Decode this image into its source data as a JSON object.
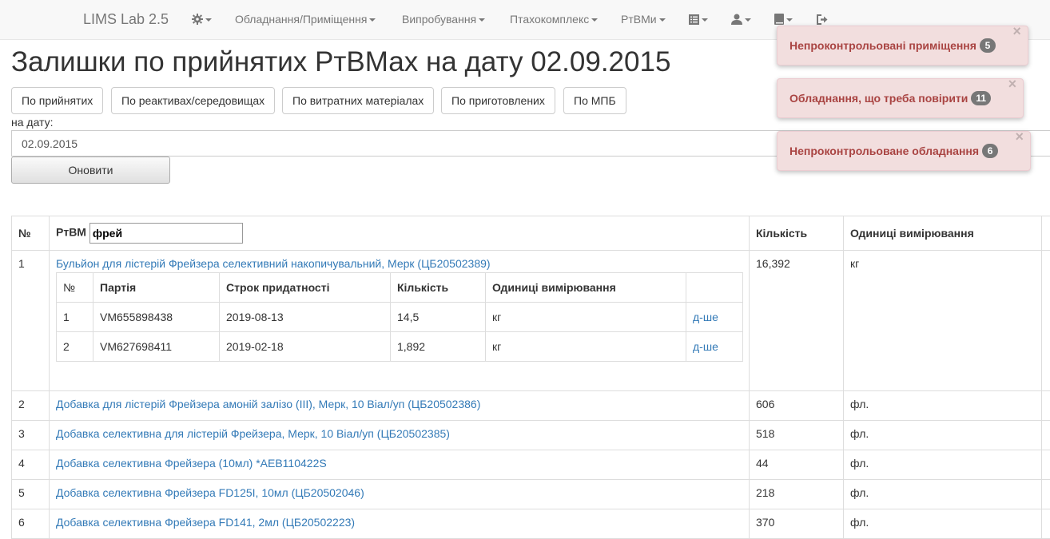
{
  "nav": {
    "brand": "LIMS Lab 2.5",
    "menus": [
      "Обладнання/Приміщення",
      "Випробування",
      "Птахокомплекс",
      "РтВМи"
    ]
  },
  "page": {
    "title": "Залишки по прийнятих РтВМах на дату 02.09.2015",
    "buttons": [
      "По прийнятих",
      "По реактивах/середовищах",
      "По витратних матеріалах",
      "По приготовлених",
      "По МПБ"
    ],
    "date_label": "на дату:",
    "date_value": "02.09.2015",
    "refresh_label": "Оновити"
  },
  "alerts": [
    {
      "text": "Непроконтрольовані приміщення",
      "count": "5"
    },
    {
      "text": "Обладнання, що треба повірити",
      "count": "11"
    },
    {
      "text": "Непроконтрольоване обладнання",
      "count": "6"
    }
  ],
  "alert_close": "×",
  "table": {
    "headers": {
      "num": "№",
      "item": "РтВМ",
      "qty": "Кількість",
      "unit": "Одиниці вимірювання"
    },
    "filter_value": "фрей",
    "rows": [
      {
        "num": "1",
        "name": "Бульйон для лістерій Фрейзера селективний накопичувальний, Мерк (ЦБ20502389)",
        "qty": "16,392",
        "unit": "кг"
      },
      {
        "num": "2",
        "name": "Добавка для лістерій Фрейзера амоній залізо (III), Мерк, 10 Віал/уп (ЦБ20502386)",
        "qty": "606",
        "unit": "фл."
      },
      {
        "num": "3",
        "name": "Добавка селективна для лістерій Фрейзера, Мерк, 10 Віал/уп (ЦБ20502385)",
        "qty": "518",
        "unit": "фл."
      },
      {
        "num": "4",
        "name": "Добавка селективна Фрейзера (10мл) *AEB110422S",
        "qty": "44",
        "unit": "фл."
      },
      {
        "num": "5",
        "name": "Добавка селективна Фрейзера FD125I, 10мл (ЦБ20502046)",
        "qty": "218",
        "unit": "фл."
      },
      {
        "num": "6",
        "name": "Добавка селективна Фрейзера FD141, 2мл (ЦБ20502223)",
        "qty": "370",
        "unit": "фл."
      }
    ],
    "sub": {
      "headers": {
        "num": "№",
        "batch": "Партія",
        "expiry": "Строк придатності",
        "qty": "Кількість",
        "unit": "Одиниці вимірювання"
      },
      "rows": [
        {
          "num": "1",
          "batch": "VM655898438",
          "expiry": "2019-08-13",
          "qty": "14,5",
          "unit": "кг",
          "more": "д-ше"
        },
        {
          "num": "2",
          "batch": "VM627698411",
          "expiry": "2019-02-18",
          "qty": "1,892",
          "unit": "кг",
          "more": "д-ше"
        }
      ]
    }
  }
}
